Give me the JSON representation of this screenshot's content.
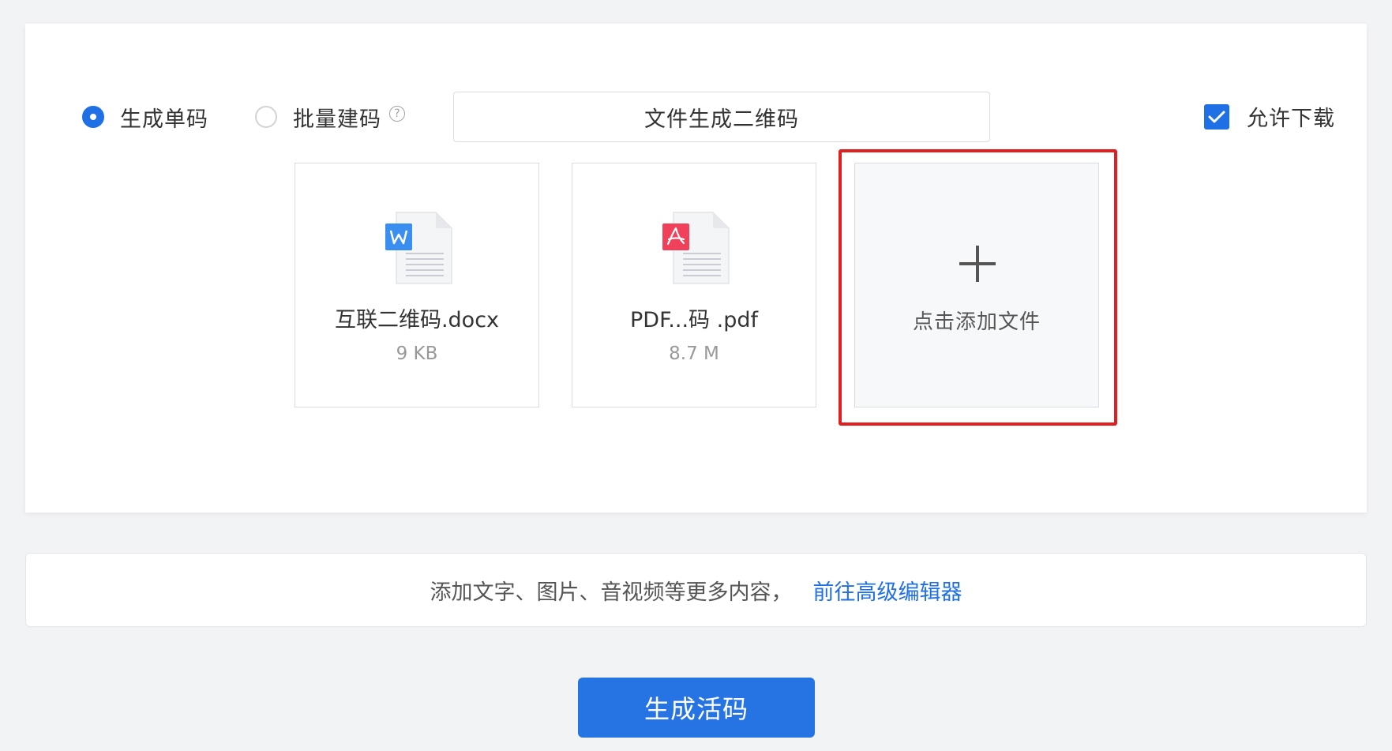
{
  "modes": {
    "single": {
      "label": "生成单码",
      "selected": true
    },
    "batch": {
      "label": "批量建码",
      "selected": false,
      "help": "?"
    }
  },
  "title_input": {
    "value": "文件生成二维码"
  },
  "allow_download": {
    "label": "允许下载",
    "checked": true
  },
  "files": [
    {
      "name": "互联二维码.docx",
      "size": "9 KB",
      "type": "word-doc-icon",
      "color": "#3a8ef0"
    },
    {
      "name": "PDF...码 .pdf",
      "size": "8.7 M",
      "type": "pdf-doc-icon",
      "color": "#f0405a"
    }
  ],
  "add_file": {
    "label": "点击添加文件"
  },
  "editor_bar": {
    "text": "添加文字、图片、音视频等更多内容，",
    "link": "前往高级编辑器"
  },
  "generate_button": {
    "label": "生成活码"
  },
  "colors": {
    "accent": "#1f6fe5",
    "highlight": "#e02020",
    "background": "#f2f3f5"
  }
}
